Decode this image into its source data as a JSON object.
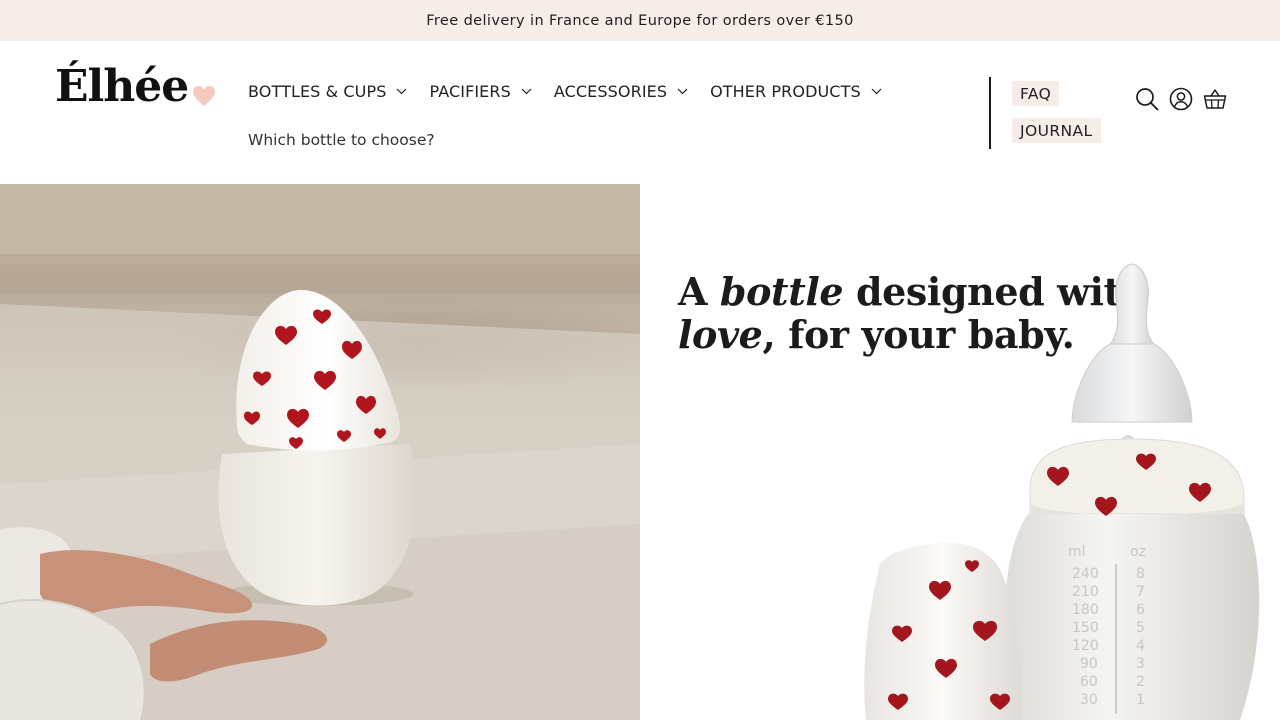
{
  "announcement": {
    "text": "Free delivery in France and Europe for orders over €150"
  },
  "logo": {
    "text": "Élhée",
    "heart_color": "#f5c9bd"
  },
  "nav": {
    "items": [
      {
        "label": "BOTTLES & CUPS"
      },
      {
        "label": "PACIFIERS"
      },
      {
        "label": "ACCESSORIES"
      },
      {
        "label": "OTHER PRODUCTS"
      }
    ],
    "secondary": "Which bottle to choose?"
  },
  "side_links": {
    "faq": "FAQ",
    "journal": "JOURNAL"
  },
  "icons": [
    "search-icon",
    "account-icon",
    "basket-icon"
  ],
  "hero": {
    "title_part1": "A ",
    "title_italic1": "bottle",
    "title_part2": " designed with",
    "title_italic2": "love",
    "title_part3": ", for your baby."
  },
  "colors": {
    "accent_bg": "#f6ece8",
    "heart_red": "#a3161d"
  }
}
